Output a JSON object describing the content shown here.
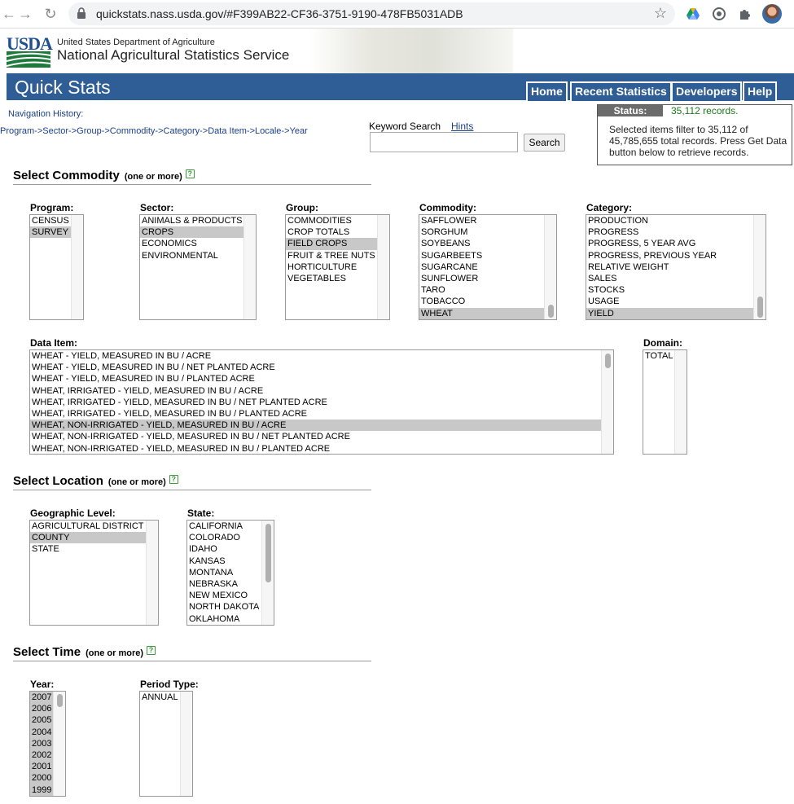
{
  "browser": {
    "url": "quickstats.nass.usda.gov/#F399AB22-CF36-3751-9190-478FB5031ADB",
    "back_icon": "←",
    "forward_icon": "→",
    "reload_icon": "↻",
    "star_icon": "☆"
  },
  "banner": {
    "logo_text": "USDA",
    "department": "United States Department of Agriculture",
    "service": "National Agricultural Statistics Service"
  },
  "app": {
    "title": "Quick Stats",
    "nav": [
      "Home",
      "Recent Statistics",
      "Developers",
      "Help"
    ]
  },
  "navigation": {
    "history_label": "Navigation History:",
    "breadcrumb": "Program->Sector->Group->Commodity->Category->Data Item->Locale->Year"
  },
  "search": {
    "label": "Keyword Search",
    "hints": "Hints",
    "value": "",
    "button": "Search"
  },
  "status": {
    "label": "Status:",
    "records": "35,112 records.",
    "message": "Selected items filter to 35,112 of 45,785,655 total records. Press Get Data button below to retrieve records."
  },
  "sections": {
    "commodity": {
      "title": "Select Commodity",
      "sub": "(one or more)",
      "help": "?"
    },
    "location": {
      "title": "Select Location",
      "sub": "(one or more)",
      "help": "?"
    },
    "time": {
      "title": "Select Time",
      "sub": "(one or more)",
      "help": "?"
    }
  },
  "lists": {
    "program": {
      "label": "Program:",
      "options": [
        "CENSUS",
        "SURVEY"
      ],
      "selected": [
        1
      ]
    },
    "sector": {
      "label": "Sector:",
      "options": [
        "ANIMALS & PRODUCTS",
        "CROPS",
        "ECONOMICS",
        "ENVIRONMENTAL"
      ],
      "selected": [
        1
      ]
    },
    "group": {
      "label": "Group:",
      "options": [
        "COMMODITIES",
        "CROP TOTALS",
        "FIELD CROPS",
        "FRUIT & TREE NUTS",
        "HORTICULTURE",
        "VEGETABLES"
      ],
      "selected": [
        2
      ]
    },
    "commodity": {
      "label": "Commodity:",
      "options": [
        "SAFFLOWER",
        "SORGHUM",
        "SOYBEANS",
        "SUGARBEETS",
        "SUGARCANE",
        "SUNFLOWER",
        "TARO",
        "TOBACCO",
        "WHEAT"
      ],
      "selected": [
        8
      ]
    },
    "category": {
      "label": "Category:",
      "options": [
        "PRODUCTION",
        "PROGRESS",
        "PROGRESS, 5 YEAR AVG",
        "PROGRESS, PREVIOUS YEAR",
        "RELATIVE WEIGHT",
        "SALES",
        "STOCKS",
        "USAGE",
        "YIELD"
      ],
      "selected": [
        8
      ]
    },
    "data_item": {
      "label": "Data Item:",
      "options": [
        "WHEAT - YIELD, MEASURED IN BU / ACRE",
        "WHEAT - YIELD, MEASURED IN BU / NET PLANTED ACRE",
        "WHEAT - YIELD, MEASURED IN BU / PLANTED ACRE",
        "WHEAT, IRRIGATED - YIELD, MEASURED IN BU / ACRE",
        "WHEAT, IRRIGATED - YIELD, MEASURED IN BU / NET PLANTED ACRE",
        "WHEAT, IRRIGATED - YIELD, MEASURED IN BU / PLANTED ACRE",
        "WHEAT, NON-IRRIGATED - YIELD, MEASURED IN BU / ACRE",
        "WHEAT, NON-IRRIGATED - YIELD, MEASURED IN BU / NET PLANTED ACRE",
        "WHEAT, NON-IRRIGATED - YIELD, MEASURED IN BU / PLANTED ACRE"
      ],
      "selected": [
        6
      ]
    },
    "domain": {
      "label": "Domain:",
      "options": [
        "TOTAL"
      ],
      "selected": []
    },
    "geo_level": {
      "label": "Geographic Level:",
      "options": [
        "AGRICULTURAL DISTRICT",
        "COUNTY",
        "STATE"
      ],
      "selected": [
        1
      ]
    },
    "state": {
      "label": "State:",
      "options": [
        "CALIFORNIA",
        "COLORADO",
        "IDAHO",
        "KANSAS",
        "MONTANA",
        "NEBRASKA",
        "NEW MEXICO",
        "NORTH DAKOTA",
        "OKLAHOMA"
      ],
      "selected": []
    },
    "year": {
      "label": "Year:",
      "options": [
        "2007",
        "2006",
        "2005",
        "2004",
        "2003",
        "2002",
        "2001",
        "2000",
        "1999"
      ],
      "selected": [
        0,
        1,
        2,
        3,
        4,
        5,
        6,
        7,
        8
      ]
    },
    "period_type": {
      "label": "Period Type:",
      "options": [
        "ANNUAL"
      ],
      "selected": []
    }
  }
}
